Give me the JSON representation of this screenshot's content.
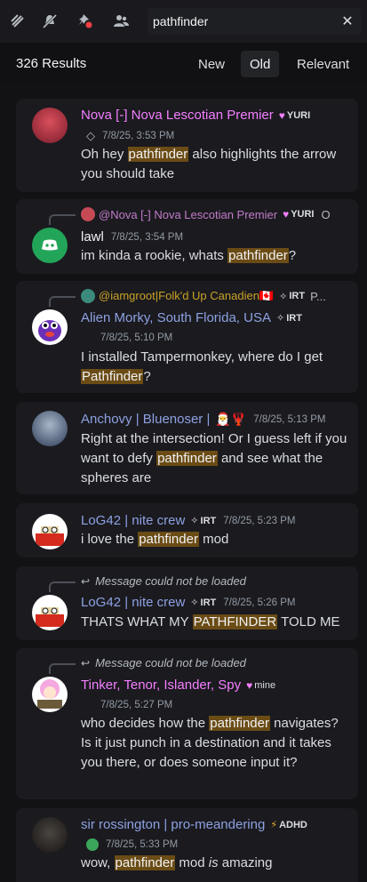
{
  "search": {
    "query": "pathfinder"
  },
  "results": {
    "count_label": "326 Results",
    "sort_options": [
      "New",
      "Old",
      "Relevant"
    ],
    "active_sort": "Old"
  },
  "messages": [
    {
      "author": "Nova [-] Nova Lescotian Premier",
      "author_color": "#f47fff",
      "tag": "YURI",
      "timestamp": "7/8/25, 3:53 PM",
      "text_parts": [
        "Oh hey ",
        "pathfinder",
        " also highlights the arrow you should take"
      ]
    },
    {
      "reply_author": "@Nova [-] Nova Lescotian Premier",
      "reply_tag": "YURI",
      "reply_extra": "O",
      "author": "lawl",
      "author_color": "#f2f3f5",
      "timestamp": "7/8/25, 3:54 PM",
      "text_parts": [
        "im kinda a rookie, whats ",
        "pathfinder",
        "?"
      ]
    },
    {
      "reply_author": "@iamgroot|Folk'd Up Canadien🇨🇦",
      "reply_tag": "IRT",
      "reply_extra": "P...",
      "author": "Alien Morky, South Florida, USA",
      "author_color": "#8ea1e1",
      "tag": "IRT",
      "timestamp": "7/8/25, 5:10 PM",
      "text_parts": [
        "I installed Tampermonkey, where do I get ",
        "Pathfinder",
        "?"
      ]
    },
    {
      "author": "Anchovy | Bluenoser |",
      "author_color": "#8ea1e1",
      "emoji": "🎅🦞",
      "timestamp": "7/8/25, 5:13 PM",
      "text_parts": [
        "Right at the intersection! Or I guess left if you want to defy ",
        "pathfinder",
        " and see what the spheres are"
      ]
    },
    {
      "author": "LoG42 | nite crew",
      "author_color": "#8ea1e1",
      "tag": "IRT",
      "timestamp": "7/8/25, 5:23 PM",
      "text_parts": [
        "i love the ",
        "pathfinder",
        " mod"
      ]
    },
    {
      "reply_text": "Message could not be loaded",
      "author": "LoG42 | nite crew",
      "author_color": "#8ea1e1",
      "tag": "IRT",
      "timestamp": "7/8/25, 5:26 PM",
      "text_parts": [
        "THATS WHAT MY ",
        "PATHFINDER",
        " TOLD ME"
      ]
    },
    {
      "reply_text": "Message could not be loaded",
      "author": "Tinker, Tenor, Islander, Spy",
      "author_color": "#f47fff",
      "tag": "mine",
      "timestamp": "7/8/25, 5:27 PM",
      "text_parts": [
        "who decides how the ",
        "pathfinder",
        " navigates? Is it just punch in a destination and it takes you there, or does someone input it?"
      ]
    },
    {
      "author": "sir rossington | pro-meandering",
      "author_color": "#8ea1e1",
      "tag": "ADHD",
      "timestamp": "7/8/25, 5:33 PM",
      "text_parts": [
        "wow, ",
        "pathfinder",
        " mod ",
        "is",
        " amazing"
      ]
    }
  ],
  "colors": {
    "highlight": "#6b4c15",
    "background": "#121214",
    "card": "#1a1a1f"
  },
  "icons": [
    "threads-icon",
    "mute-icon",
    "pin-icon",
    "members-icon",
    "clear-search-icon",
    "reply-arrow-icon"
  ]
}
